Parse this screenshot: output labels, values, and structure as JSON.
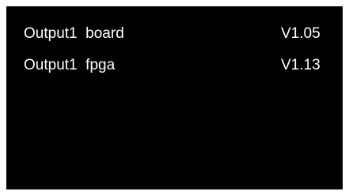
{
  "rows": [
    {
      "label": "Output1  board",
      "version": "V1.05"
    },
    {
      "label": "Output1  fpga",
      "version": "V1.13"
    }
  ],
  "colors": {
    "frame": "#ffffff",
    "screen_background": "#000000",
    "text": "#ffffff"
  }
}
